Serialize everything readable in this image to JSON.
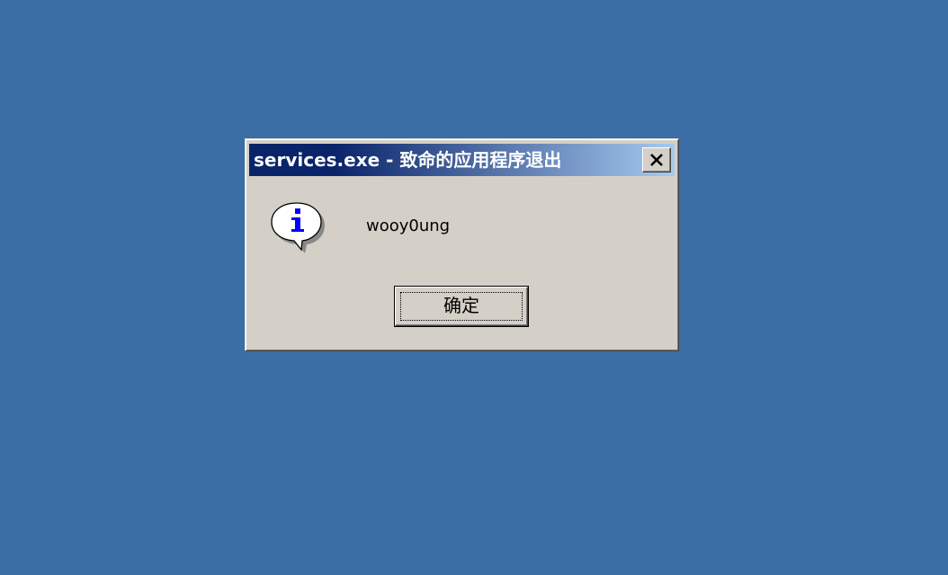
{
  "desktop": {
    "background_color": "#3b6ea5"
  },
  "dialog": {
    "title": "services.exe - 致命的应用程序退出",
    "message": "wooy0ung",
    "ok_label": "确定",
    "close_icon": "close-icon",
    "message_icon": "information-icon",
    "face_color": "#d4d0c8",
    "title_gradient_start": "#0a246a",
    "title_gradient_end": "#a6caf0"
  }
}
